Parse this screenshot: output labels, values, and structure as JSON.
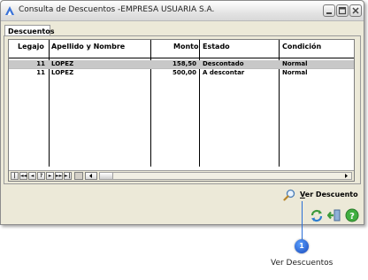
{
  "window": {
    "title": "Consulta de Descuentos -EMPRESA USUARIA S.A."
  },
  "tabs": [
    {
      "label": "Descuentos"
    }
  ],
  "table": {
    "columns": [
      "Legajo",
      "Apellido y Nombre",
      "Monto",
      "Estado",
      "Condición"
    ],
    "rows": [
      {
        "legajo": "11",
        "nombre": "LOPEZ",
        "monto": "158,50",
        "estado": "Descontado",
        "condicion": "Normal"
      },
      {
        "legajo": "11",
        "nombre": "LOPEZ",
        "monto": "500,00",
        "estado": "A descontar",
        "condicion": "Normal"
      }
    ]
  },
  "navigator": {
    "buttons": [
      "|◄",
      "◄◄",
      "◄",
      "?",
      "►",
      "►►",
      "►|"
    ]
  },
  "actions": {
    "ver_descuento_prefix": "V",
    "ver_descuento_rest": "er Descuento"
  },
  "callout": {
    "number": "1",
    "label": "Ver Descuentos"
  },
  "icons": {
    "app": "app-logo-icon",
    "search": "magnifier-icon",
    "refresh": "refresh-arrows-icon",
    "exit": "exit-door-icon",
    "help": "help-icon"
  },
  "colors": {
    "accent": "#2b6fd6",
    "selected_row": "#c8c8c8",
    "window_bg": "#ece9d8"
  }
}
